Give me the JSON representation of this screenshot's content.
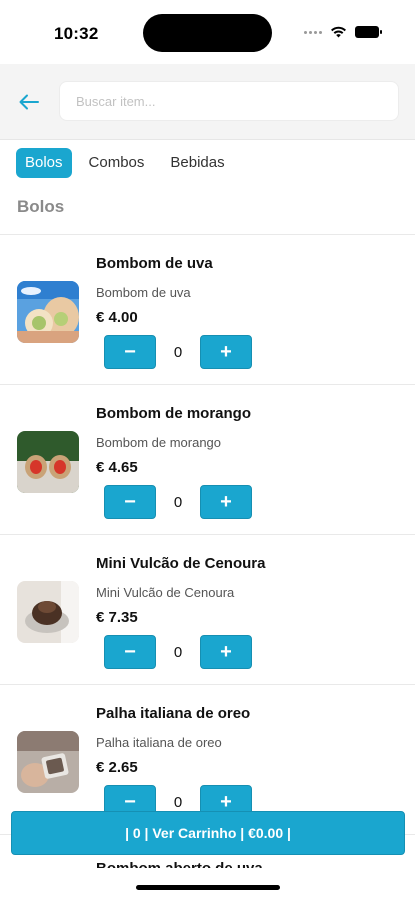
{
  "status_bar": {
    "time": "10:32"
  },
  "search": {
    "placeholder": "Buscar item..."
  },
  "tabs": [
    {
      "label": "Bolos",
      "active": true
    },
    {
      "label": "Combos",
      "active": false
    },
    {
      "label": "Bebidas",
      "active": false
    }
  ],
  "section_title": "Bolos",
  "products": [
    {
      "name": "Bombom de uva",
      "description": "Bombom de uva",
      "price": "€ 4.00",
      "quantity": "0",
      "image": "grape-bonbon-photo"
    },
    {
      "name": "Bombom de morango",
      "description": "Bombom de morango",
      "price": "€ 4.65",
      "quantity": "0",
      "image": "strawberry-bonbon-photo"
    },
    {
      "name": "Mini Vulcão de Cenoura",
      "description": "Mini Vulcão de Cenoura",
      "price": "€ 7.35",
      "quantity": "0",
      "image": "carrot-volcano-cake-photo"
    },
    {
      "name": "Palha italiana de oreo",
      "description": "Palha italiana de oreo",
      "price": "€ 2.65",
      "quantity": "0",
      "image": "oreo-palha-italiana-photo"
    }
  ],
  "qty_controls": {
    "minus": "−",
    "plus": "+"
  },
  "cart": {
    "label": "| 0 | Ver Carrinho  | €0.00 |"
  },
  "next_item_peek": "Bombom aberto de uva",
  "colors": {
    "accent": "#1aa6cf",
    "header_bg": "#f4f4f4"
  }
}
